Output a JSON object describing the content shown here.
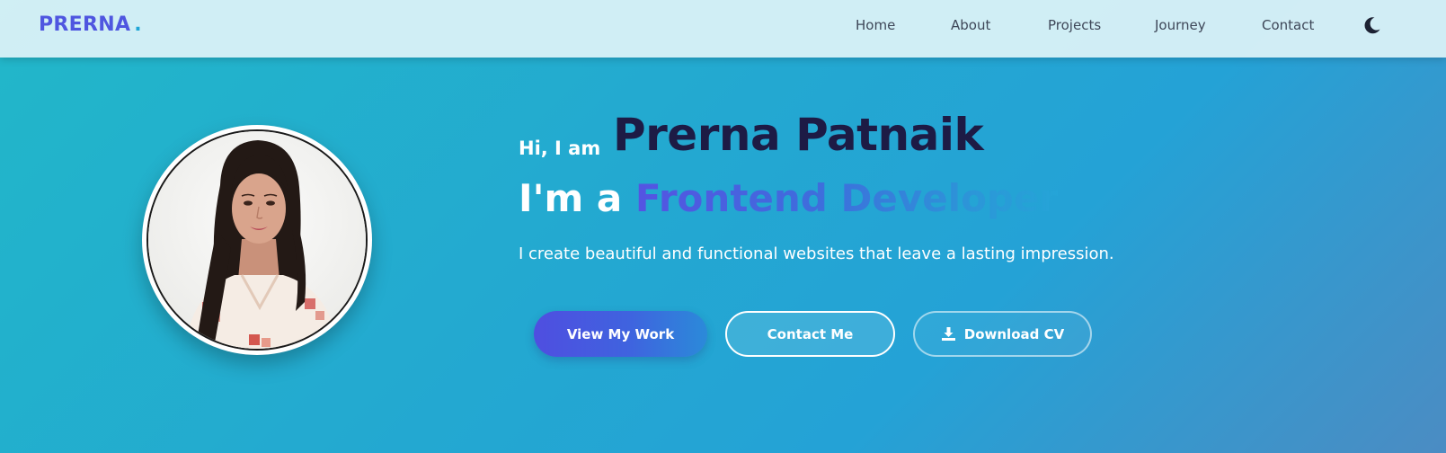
{
  "navbar": {
    "logo": "PRERNA",
    "logo_dot": ".",
    "links": [
      "Home",
      "About",
      "Projects",
      "Journey",
      "Contact"
    ],
    "theme_toggle_icon": "moon-icon"
  },
  "hero": {
    "greeting": "Hi, I am",
    "name": "Prerna Patnaik",
    "role_prefix": "I'm a",
    "role": "Frontend Developer",
    "tagline": "I create beautiful and functional websites that leave a lasting impression.",
    "profile_alt": "Prerna Patnaik profile photo"
  },
  "buttons": {
    "view_work": "View My Work",
    "contact_me": "Contact Me",
    "download_cv": "Download CV",
    "download_icon": "download-icon"
  },
  "colors": {
    "accent_indigo": "#4f56e0",
    "accent_blue": "#1fa5d6",
    "name_color": "#1d1b45",
    "hero_bg_start": "#22b7c9",
    "hero_bg_end": "#4b8cc3"
  }
}
